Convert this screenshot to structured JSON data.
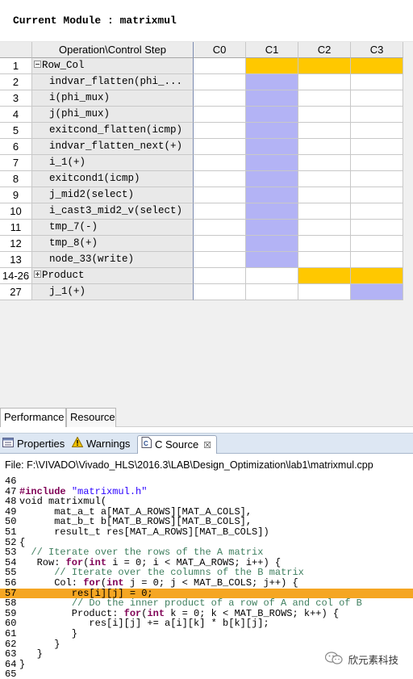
{
  "module": {
    "label": "Current Module : matrixmul"
  },
  "schedule": {
    "headers": {
      "num": "",
      "operation": "Operation\\Control Step",
      "c0": "C0",
      "c1": "C1",
      "c2": "C2",
      "c3": "C3"
    },
    "colors": {
      "blue": "#b3b3f5",
      "orange": "#ffc800"
    },
    "rows": [
      {
        "num": "1",
        "op": "Row_Col",
        "expander": "minus",
        "fills": [
          "",
          "orange",
          "orange",
          "orange"
        ]
      },
      {
        "num": "2",
        "op": "indvar_flatten(phi_...",
        "fills": [
          "",
          "blue",
          "",
          ""
        ]
      },
      {
        "num": "3",
        "op": "i(phi_mux)",
        "fills": [
          "",
          "blue",
          "",
          ""
        ]
      },
      {
        "num": "4",
        "op": "j(phi_mux)",
        "fills": [
          "",
          "blue",
          "",
          ""
        ]
      },
      {
        "num": "5",
        "op": "exitcond_flatten(icmp)",
        "fills": [
          "",
          "blue",
          "",
          ""
        ]
      },
      {
        "num": "6",
        "op": "indvar_flatten_next(+)",
        "fills": [
          "",
          "blue",
          "",
          ""
        ]
      },
      {
        "num": "7",
        "op": "i_1(+)",
        "fills": [
          "",
          "blue",
          "",
          ""
        ]
      },
      {
        "num": "8",
        "op": "exitcond1(icmp)",
        "fills": [
          "",
          "blue",
          "",
          ""
        ]
      },
      {
        "num": "9",
        "op": "j_mid2(select)",
        "fills": [
          "",
          "blue",
          "",
          ""
        ]
      },
      {
        "num": "10",
        "op": "i_cast3_mid2_v(select)",
        "fills": [
          "",
          "blue",
          "",
          ""
        ]
      },
      {
        "num": "11",
        "op": "tmp_7(-)",
        "fills": [
          "",
          "blue",
          "",
          ""
        ]
      },
      {
        "num": "12",
        "op": "tmp_8(+)",
        "fills": [
          "",
          "blue",
          "",
          ""
        ]
      },
      {
        "num": "13",
        "op": "node_33(write)",
        "fills": [
          "",
          "blue",
          "",
          ""
        ]
      },
      {
        "num": "14-26",
        "op": "Product",
        "expander": "plus",
        "fills": [
          "",
          "",
          "orange",
          "orange"
        ]
      },
      {
        "num": "27",
        "op": "j_1(+)",
        "fills": [
          "",
          "",
          "",
          "blue"
        ]
      }
    ]
  },
  "bottom_tabs": {
    "performance": "Performance",
    "resource": "Resource"
  },
  "views": {
    "properties": "Properties",
    "warnings": "Warnings",
    "c_source": "C Source",
    "close_glyph": "☒"
  },
  "file_path": "File: F:\\VIVADO\\Vivado_HLS\\2016.3\\LAB\\Design_Optimization\\lab1\\matrixmul.cpp",
  "editor": {
    "highlight_color": "#f5a623",
    "lines": [
      {
        "num": "46",
        "code": ""
      },
      {
        "num": "47",
        "code": "#include \"matrixmul.h\""
      },
      {
        "num": "48",
        "code": "void matrixmul("
      },
      {
        "num": "49",
        "code": "      mat_a_t a[MAT_A_ROWS][MAT_A_COLS],"
      },
      {
        "num": "50",
        "code": "      mat_b_t b[MAT_B_ROWS][MAT_B_COLS],"
      },
      {
        "num": "51",
        "code": "      result_t res[MAT_A_ROWS][MAT_B_COLS])"
      },
      {
        "num": "52",
        "code": "{"
      },
      {
        "num": "53",
        "code": "  // Iterate over the rows of the A matrix"
      },
      {
        "num": "54",
        "code": "   Row: for(int i = 0; i < MAT_A_ROWS; i++) {"
      },
      {
        "num": "55",
        "code": "      // Iterate over the columns of the B matrix"
      },
      {
        "num": "56",
        "code": "      Col: for(int j = 0; j < MAT_B_COLS; j++) {"
      },
      {
        "num": "57",
        "code": "         res[i][j] = 0;"
      },
      {
        "num": "58",
        "code": "         // Do the inner product of a row of A and col of B"
      },
      {
        "num": "59",
        "code": "         Product: for(int k = 0; k < MAT_B_ROWS; k++) {"
      },
      {
        "num": "60",
        "code": "            res[i][j] += a[i][k] * b[k][j];"
      },
      {
        "num": "61",
        "code": "         }"
      },
      {
        "num": "62",
        "code": "      }"
      },
      {
        "num": "63",
        "code": "   }"
      },
      {
        "num": "64",
        "code": "}"
      },
      {
        "num": "65",
        "code": ""
      }
    ],
    "highlighted_line": "57"
  },
  "watermark": {
    "text": "欣元素科技"
  }
}
